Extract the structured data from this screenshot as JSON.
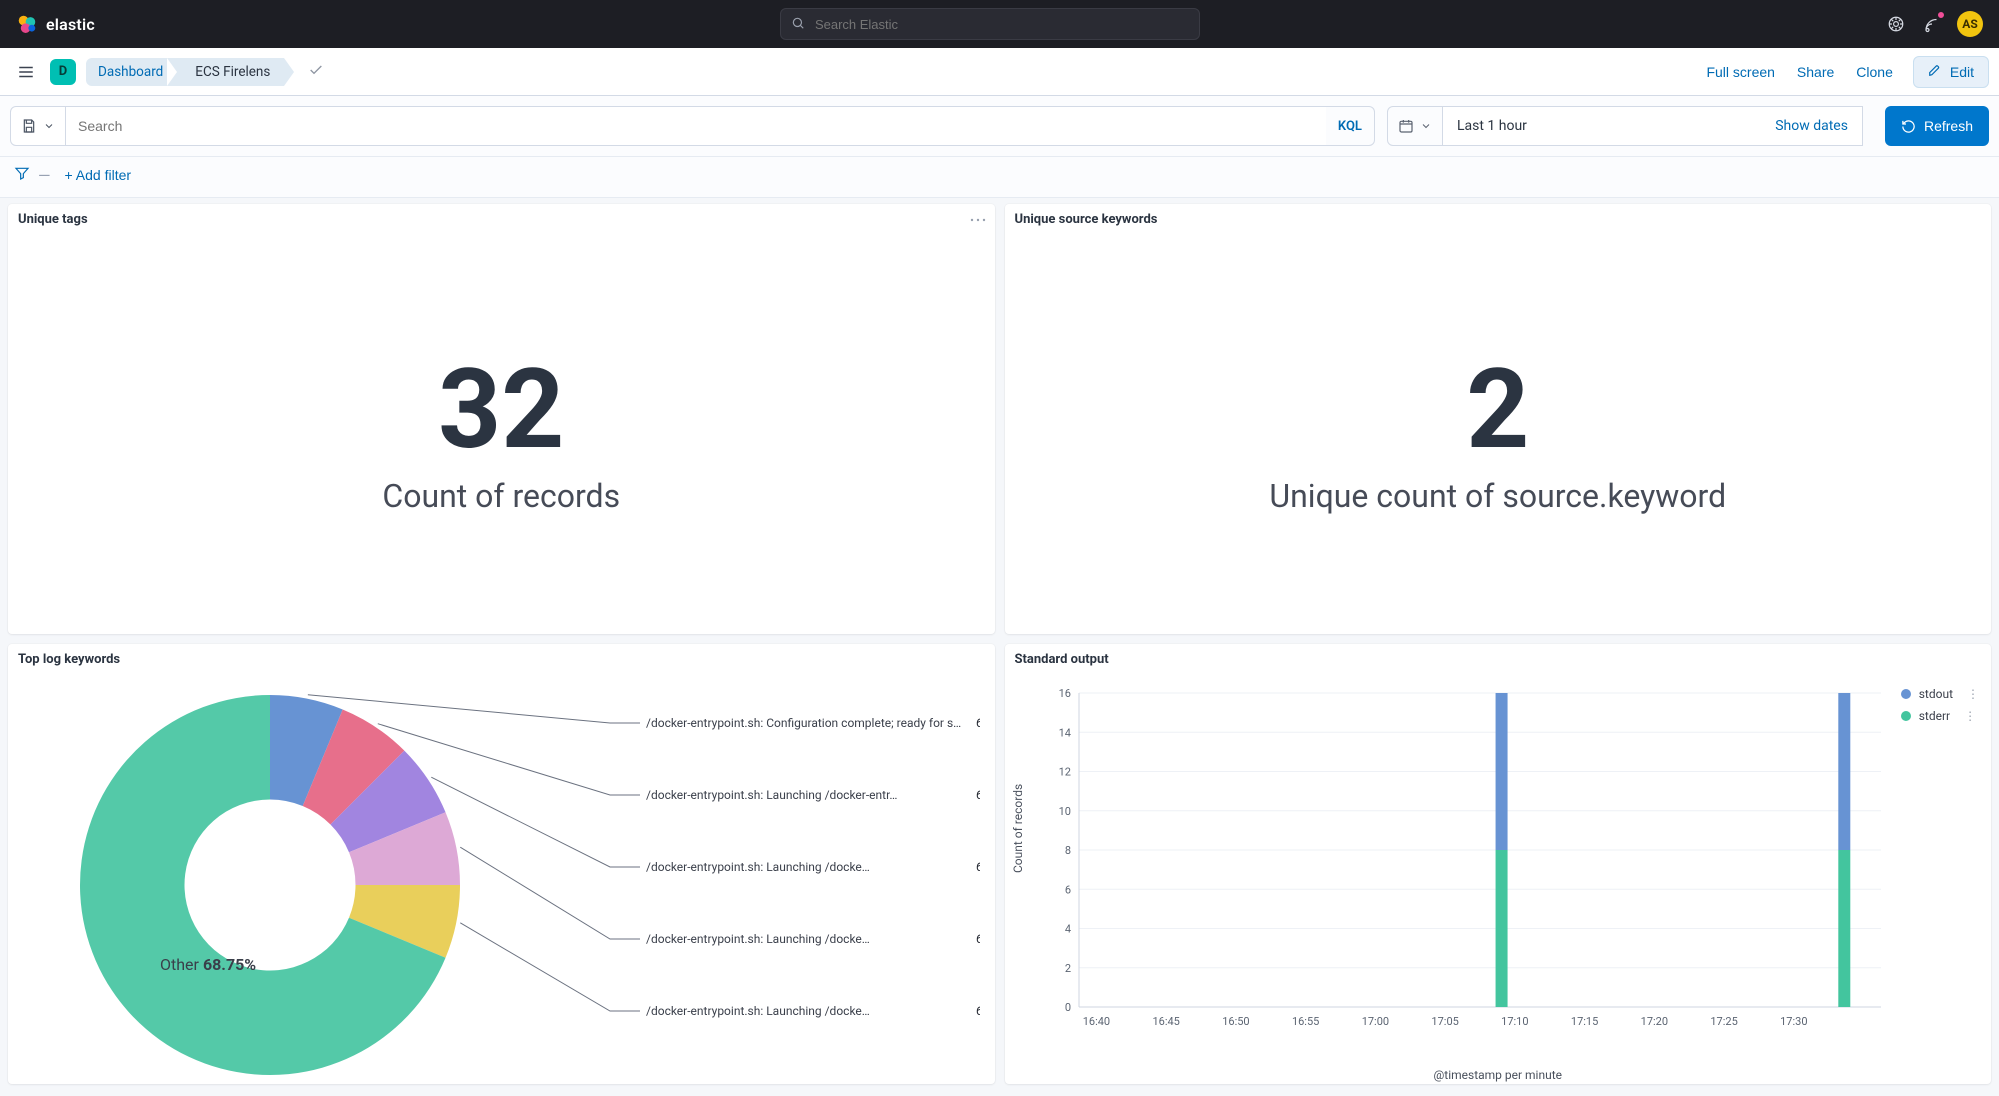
{
  "brand": {
    "name": "elastic"
  },
  "global_search": {
    "placeholder": "Search Elastic"
  },
  "topbar": {
    "avatar_initials": "AS"
  },
  "subbar": {
    "space_letter": "D",
    "breadcrumbs": [
      "Dashboard",
      "ECS Firelens"
    ],
    "actions": {
      "fullscreen": "Full screen",
      "share": "Share",
      "clone": "Clone",
      "edit": "Edit"
    }
  },
  "query": {
    "placeholder": "Search",
    "language_label": "KQL",
    "time_label": "Last 1 hour",
    "show_dates": "Show dates",
    "refresh": "Refresh"
  },
  "filterbar": {
    "add_filter": "+ Add filter"
  },
  "panels": {
    "metric1": {
      "title": "Unique tags",
      "value": "32",
      "caption": "Count of records"
    },
    "metric2": {
      "title": "Unique source keywords",
      "value": "2",
      "caption": "Unique count of source.keyword"
    },
    "donut": {
      "title": "Top log keywords",
      "center_prefix": "Other ",
      "center_value": "68.75%"
    },
    "bars": {
      "title": "Standard output",
      "xlabel": "@timestamp per minute",
      "ylabel": "Count of records",
      "legend": {
        "a": "stdout",
        "b": "stderr"
      }
    }
  },
  "chart_data": [
    {
      "id": "top_log_keywords",
      "type": "pie",
      "title": "Top log keywords",
      "slices": [
        {
          "name": "Other",
          "value": 68.75,
          "color": "#54c9a8"
        },
        {
          "name": "/docker-entrypoint.sh: Configuration complete; ready for s…",
          "value": 6.25,
          "color": "#6793d3"
        },
        {
          "name": "/docker-entrypoint.sh: Launching /docker-entr…",
          "value": 6.25,
          "color": "#e76f8b"
        },
        {
          "name": "/docker-entrypoint.sh: Launching /docke…",
          "value": 6.25,
          "color": "#a185e0"
        },
        {
          "name": "/docker-entrypoint.sh: Launching /docke…",
          "value": 6.25,
          "color": "#dda9d6"
        },
        {
          "name": "/docker-entrypoint.sh: Launching /docke…",
          "value": 6.25,
          "color": "#e9cf5b"
        }
      ],
      "hole": 0.45
    },
    {
      "id": "standard_output",
      "type": "bar",
      "title": "Standard output",
      "xlabel": "@timestamp per minute",
      "ylabel": "Count of records",
      "ylim": [
        0,
        16
      ],
      "yticks": [
        0,
        2,
        4,
        6,
        8,
        10,
        12,
        14,
        16
      ],
      "categories": [
        "16:40",
        "16:45",
        "16:50",
        "16:55",
        "17:00",
        "17:05",
        "17:10",
        "17:15",
        "17:20",
        "17:25",
        "17:30"
      ],
      "series": [
        {
          "name": "stderr",
          "color": "#43c59e",
          "values": [
            0,
            0,
            0,
            0,
            0,
            0,
            8,
            0,
            0,
            0,
            0,
            8
          ]
        },
        {
          "name": "stdout",
          "color": "#6793d3",
          "values": [
            0,
            0,
            0,
            0,
            0,
            0,
            8,
            0,
            0,
            0,
            0,
            8
          ]
        }
      ],
      "note": "Second nonzero bar occurs slightly after the last tick (~17:32)."
    }
  ]
}
